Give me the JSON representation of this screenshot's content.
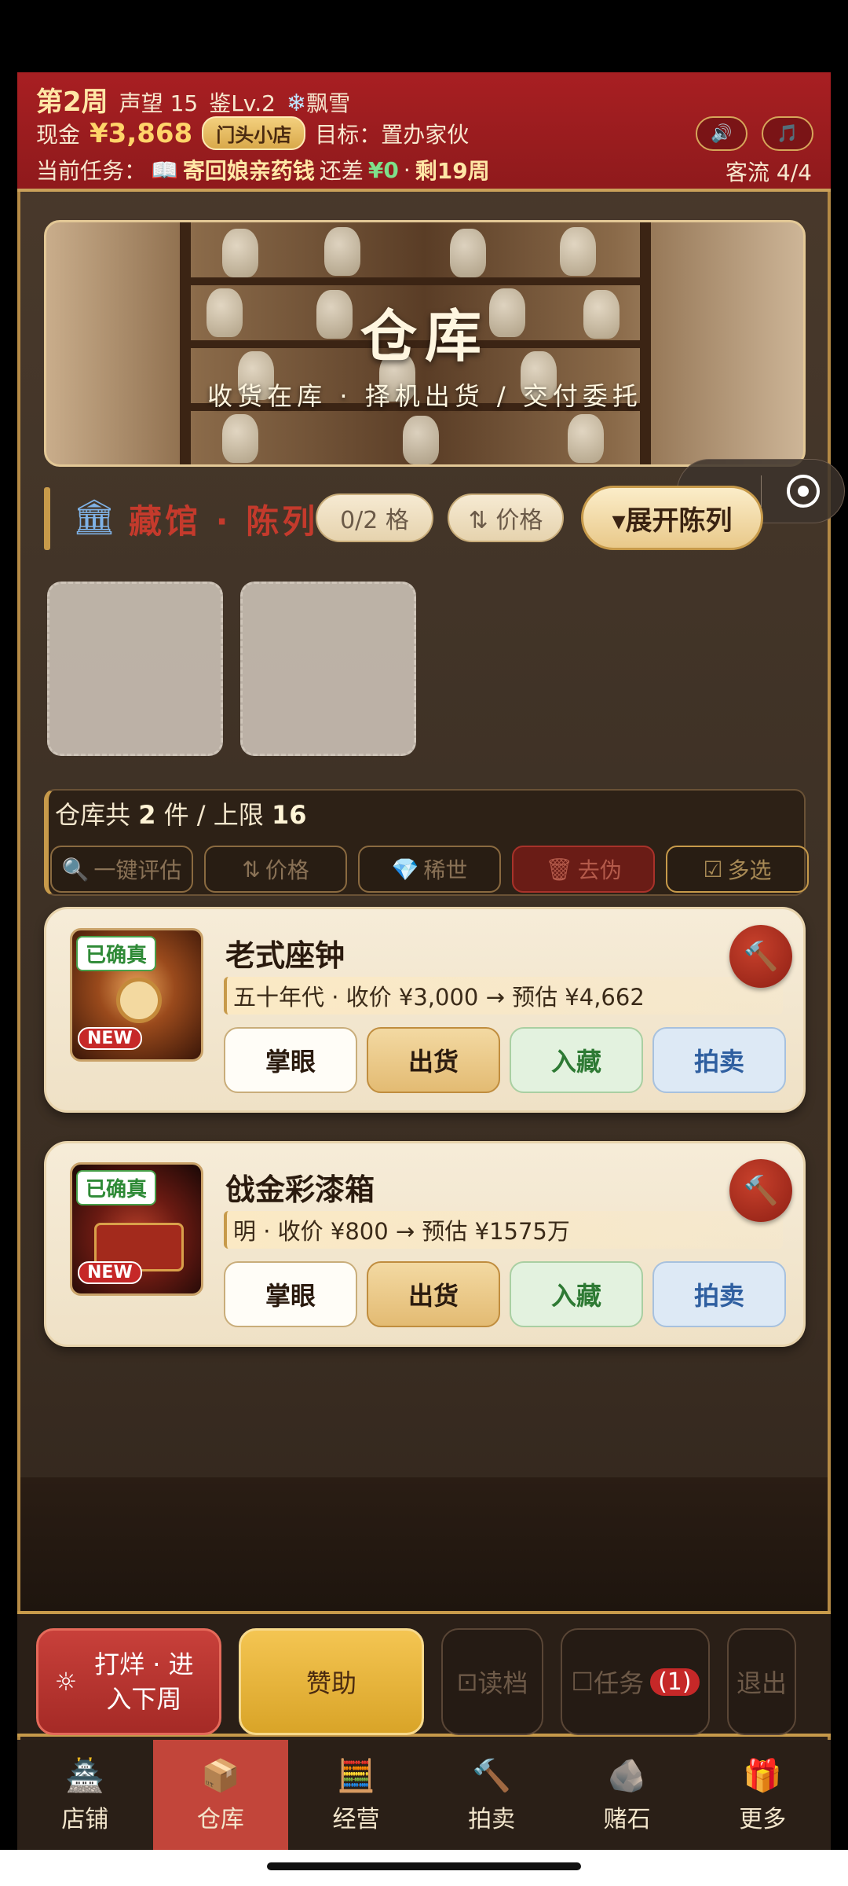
{
  "header": {
    "week": "第2周",
    "reputation": "声望 15",
    "appraisal": "鉴Lv.2",
    "weather_icon": "❄",
    "weather": "飘雪",
    "cash_label": "现金",
    "cash": "¥3,868",
    "shop_badge": "门头小店",
    "goal": "目标：置办家伙",
    "task_label": "当前任务：",
    "task_icon": "📖",
    "task_name": "寄回娘亲药钱",
    "task_gap_label": "还差",
    "task_gap_value": "¥0",
    "task_sep": "·",
    "task_weeks": "剩19周",
    "traffic": "客流 4/4",
    "sound_icon": "🔊",
    "music_icon": "🎵"
  },
  "banner": {
    "title": "仓库",
    "subtitle": "收货在库 · 择机出货 / 交付委托"
  },
  "capsule": {
    "more": "•••"
  },
  "collection": {
    "icon": "🏛",
    "title": "藏馆 · 陈列",
    "slots_pill": "0/2 格",
    "price_pill": "⇅ 价格",
    "expand_label": "▾展开陈列"
  },
  "warehouse": {
    "count_prefix": "仓库共 ",
    "count": "2",
    "count_mid": " 件 / 上限 ",
    "limit": "16",
    "filters": [
      {
        "icon": "🔍",
        "label": "一键评估"
      },
      {
        "icon": "⇅",
        "label": "价格"
      },
      {
        "icon": "💎",
        "label": "稀世"
      },
      {
        "icon": "🗑",
        "label": "去伪"
      },
      {
        "icon": "☑",
        "label": "多选"
      }
    ]
  },
  "items": [
    {
      "name": "老式座钟",
      "verified": "已确真",
      "new": "NEW",
      "meta": "五十年代 · 收价 ¥3,000 → 预估 ¥4,662",
      "hammer": "🔨",
      "actions": [
        "掌眼",
        "出货",
        "入藏",
        "拍卖"
      ]
    },
    {
      "name": "戗金彩漆箱",
      "verified": "已确真",
      "new": "NEW",
      "meta": "明 · 收价 ¥800 → 预估 ¥1575万",
      "hammer": "🔨",
      "actions": [
        "掌眼",
        "出货",
        "入藏",
        "拍卖"
      ]
    }
  ],
  "action_bar": {
    "next_icon": "☼",
    "next_label": "打烊 · 进入下周",
    "sponsor": "赞助",
    "load_icon": "⊡",
    "load": "读档",
    "task_icon": "☐",
    "task": "任务",
    "task_badge": "(1)",
    "exit": "退出"
  },
  "tabs": [
    {
      "icon": "🏯",
      "label": "店铺"
    },
    {
      "icon": "📦",
      "label": "仓库"
    },
    {
      "icon": "🧮",
      "label": "经营"
    },
    {
      "icon": "🔨",
      "label": "拍卖"
    },
    {
      "icon": "🪨",
      "label": "赌石"
    },
    {
      "icon": "🎁",
      "label": "更多"
    }
  ],
  "colors": {
    "header_red": "#a81f22",
    "gold": "#c79a4a",
    "active_tab": "#c2453a",
    "sponsor_gold": "#f4c552"
  }
}
